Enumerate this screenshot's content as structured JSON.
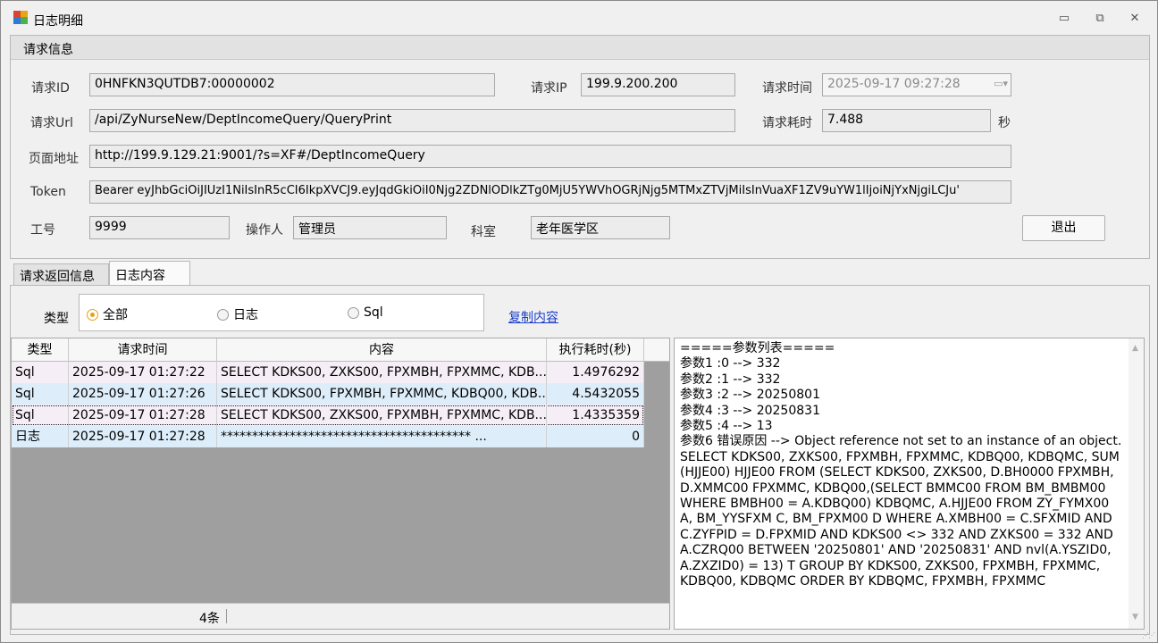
{
  "window": {
    "title": "日志明细",
    "minimize": "▭",
    "maximize": "⧉",
    "close": "✕"
  },
  "request_info": {
    "group_title": "请求信息",
    "request_id_label": "请求ID",
    "request_id": "0HNFKN3QUTDB7:00000002",
    "request_ip_label": "请求IP",
    "request_ip": "199.9.200.200",
    "request_time_label": "请求时间",
    "request_time": "2025-09-17 09:27:28",
    "request_url_label": "请求Url",
    "request_url": "/api/ZyNurseNew/DeptIncomeQuery/QueryPrint",
    "elapsed_label": "请求耗时",
    "elapsed": "7.488",
    "elapsed_unit": "秒",
    "page_address_label": "页面地址",
    "page_address": "http://199.9.129.21:9001/?s=XF#/DeptIncomeQuery",
    "token_label": "Token",
    "token": "Bearer eyJhbGciOiJIUzI1NiIsInR5cCI6IkpXVCJ9.eyJqdGkiOiI0Njg2ZDNlODlkZTg0MjU5YWVhOGRjNjg5MTMxZTVjMiIsInVuaXF1ZV9uYW1lIjoiNjYxNjgiLCJu'",
    "job_no_label": "工号",
    "job_no": "9999",
    "operator_label": "操作人",
    "operator": "管理员",
    "dept_label": "科室",
    "dept": "老年医学区",
    "exit_label": "退出"
  },
  "tabs": [
    {
      "label": "请求返回信息",
      "active": false
    },
    {
      "label": "日志内容",
      "active": true
    }
  ],
  "filter": {
    "type_label": "类型",
    "options": [
      {
        "label": "全部",
        "selected": true
      },
      {
        "label": "日志",
        "selected": false
      },
      {
        "label": "Sql",
        "selected": false
      }
    ],
    "copy_link": "复制内容"
  },
  "grid": {
    "columns": [
      "类型",
      "请求时间",
      "内容",
      "执行耗时(秒)"
    ],
    "rows": [
      {
        "type": "Sql",
        "time": "2025-09-17 01:27:22",
        "content": "SELECT KDKS00, ZXKS00, FPXMBH, FPXMMC, KDB...",
        "duration": "1.4976292"
      },
      {
        "type": "Sql",
        "time": "2025-09-17 01:27:26",
        "content": "SELECT KDKS00, FPXMBH, FPXMMC, KDBQ00, KDB...",
        "duration": "4.5432055"
      },
      {
        "type": "Sql",
        "time": "2025-09-17 01:27:28",
        "content": "SELECT KDKS00, ZXKS00, FPXMBH, FPXMMC, KDB...",
        "duration": "1.4335359"
      },
      {
        "type": "日志",
        "time": "2025-09-17 01:27:28",
        "content": "**************************************** ...",
        "duration": "0"
      }
    ],
    "count": "4条"
  },
  "log_text": "=====参数列表=====\n参数1 :0 --> 332\n参数2 :1 --> 332\n参数3 :2 --> 20250801\n参数4 :3 --> 20250831\n参数5 :4 --> 13\n参数6 错误原因 --> Object reference not set to an instance of an object.\nSELECT KDKS00, ZXKS00, FPXMBH, FPXMMC, KDBQ00, KDBQMC, SUM (HJJE00) HJJE00 FROM (SELECT KDKS00, ZXKS00, D.BH0000 FPXMBH, D.XMMC00 FPXMMC, KDBQ00,(SELECT BMMC00 FROM BM_BMBM00 WHERE BMBH00 = A.KDBQ00) KDBQMC, A.HJJE00 FROM ZY_FYMX00 A, BM_YYSFXM C, BM_FPXM00 D WHERE A.XMBH00 = C.SFXMID AND C.ZYFPID = D.FPXMID AND KDKS00 <> 332 AND ZXKS00 = 332 AND A.CZRQ00 BETWEEN '20250801' AND '20250831' AND nvl(A.YSZID0, A.ZXZID0) = 13) T GROUP BY KDKS00, ZXKS00, FPXMBH, FPXMMC, KDBQ00, KDBQMC ORDER BY KDBQMC, FPXMBH, FPXMMC"
}
